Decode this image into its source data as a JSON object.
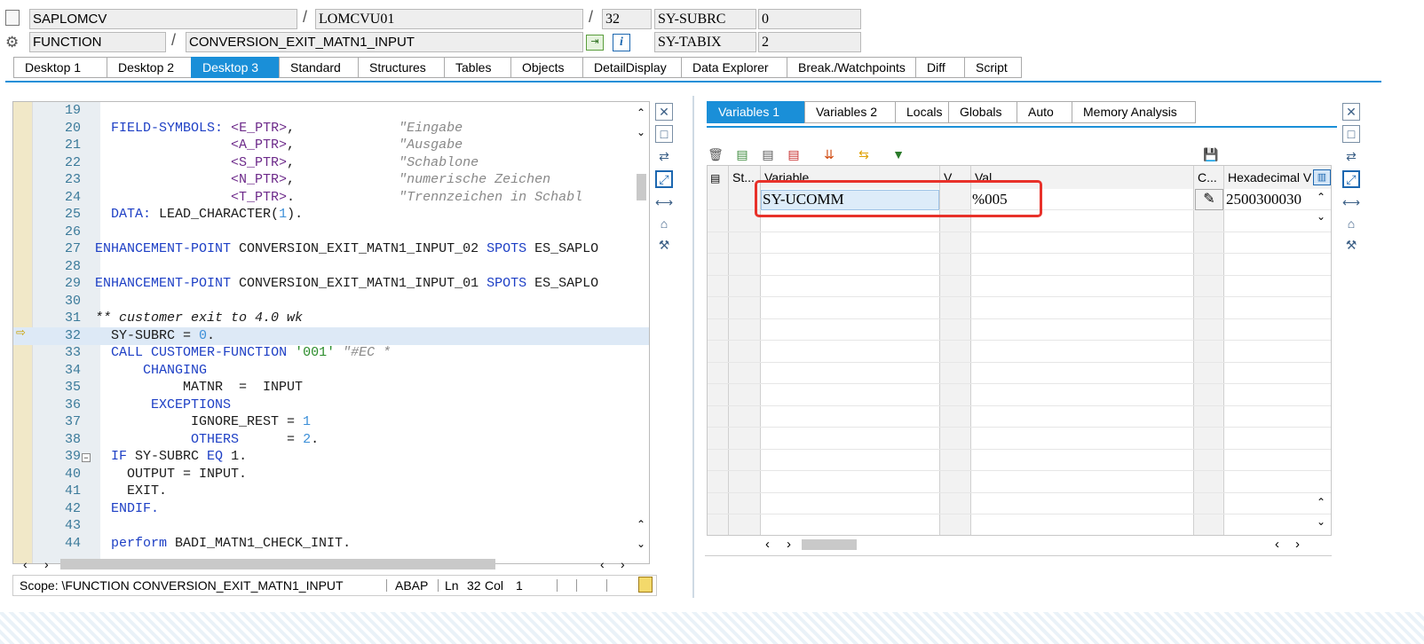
{
  "header": {
    "program": "SAPLOMCV",
    "include": "LOMCVU01",
    "line": "32",
    "sy_subrc_label": "SY-SUBRC",
    "sy_subrc_value": "0",
    "event_type": "FUNCTION",
    "event_name": "CONVERSION_EXIT_MATN1_INPUT",
    "sy_tabix_label": "SY-TABIX",
    "sy_tabix_value": "2",
    "info_icon": "i"
  },
  "tabs": [
    "Desktop 1",
    "Desktop 2",
    "Desktop 3",
    "Standard",
    "Structures",
    "Tables",
    "Objects",
    "DetailDisplay",
    "Data Explorer",
    "Break./Watchpoints",
    "Diff",
    "Script"
  ],
  "active_tab": "Desktop 3",
  "editor": {
    "lines": [
      {
        "n": "19",
        "t": ""
      },
      {
        "n": "20",
        "t": "  FIELD-SYMBOLS: <E_PTR>,             \"Eingabe"
      },
      {
        "n": "21",
        "t": "                 <A_PTR>,             \"Ausgabe"
      },
      {
        "n": "22",
        "t": "                 <S_PTR>,             \"Schablone"
      },
      {
        "n": "23",
        "t": "                 <N_PTR>,             \"numerische Zeichen"
      },
      {
        "n": "24",
        "t": "                 <T_PTR>.             \"Trennzeichen in Schabl"
      },
      {
        "n": "25",
        "t": "  DATA: LEAD_CHARACTER(1)."
      },
      {
        "n": "26",
        "t": ""
      },
      {
        "n": "27",
        "t": "ENHANCEMENT-POINT CONVERSION_EXIT_MATN1_INPUT_02 SPOTS ES_SAPLO"
      },
      {
        "n": "28",
        "t": ""
      },
      {
        "n": "29",
        "t": "ENHANCEMENT-POINT CONVERSION_EXIT_MATN1_INPUT_01 SPOTS ES_SAPLO"
      },
      {
        "n": "30",
        "t": ""
      },
      {
        "n": "31",
        "t": "** customer exit to 4.0 wk"
      },
      {
        "n": "32",
        "t": "  SY-SUBRC = 0."
      },
      {
        "n": "33",
        "t": "  CALL CUSTOMER-FUNCTION '001' \"#EC *"
      },
      {
        "n": "34",
        "t": "      CHANGING"
      },
      {
        "n": "35",
        "t": "           MATNR  =  INPUT"
      },
      {
        "n": "36",
        "t": "       EXCEPTIONS"
      },
      {
        "n": "37",
        "t": "            IGNORE_REST = 1"
      },
      {
        "n": "38",
        "t": "            OTHERS      = 2."
      },
      {
        "n": "39",
        "t": "  IF SY-SUBRC EQ 1."
      },
      {
        "n": "40",
        "t": "    OUTPUT = INPUT."
      },
      {
        "n": "41",
        "t": "    EXIT."
      },
      {
        "n": "42",
        "t": "  ENDIF."
      },
      {
        "n": "43",
        "t": ""
      },
      {
        "n": "44",
        "t": "  perform BADI_MATN1_CHECK_INIT."
      }
    ],
    "current_line": "32"
  },
  "status": {
    "scope": "Scope: \\FUNCTION CONVERSION_EXIT_MATN1_INPUT",
    "lang": "ABAP",
    "ln_label": "Ln",
    "ln_value": "32",
    "col_label": "Col",
    "col_value": "1"
  },
  "var_tabs": [
    "Variables 1",
    "Variables 2",
    "Locals",
    "Globals",
    "Auto",
    "Memory Analysis"
  ],
  "active_var_tab": "Variables 1",
  "grid": {
    "headers": [
      "St...",
      "Variable",
      "V...",
      "Val.",
      "C...",
      "Hexadecimal V"
    ],
    "rows": [
      {
        "variable": "SY-UCOMM",
        "value": "%005",
        "hex": "2500300030"
      }
    ]
  },
  "colors": {
    "accent": "#1a8fd8",
    "highlight": "#e8312a",
    "gutter": "#f1e8c8"
  }
}
